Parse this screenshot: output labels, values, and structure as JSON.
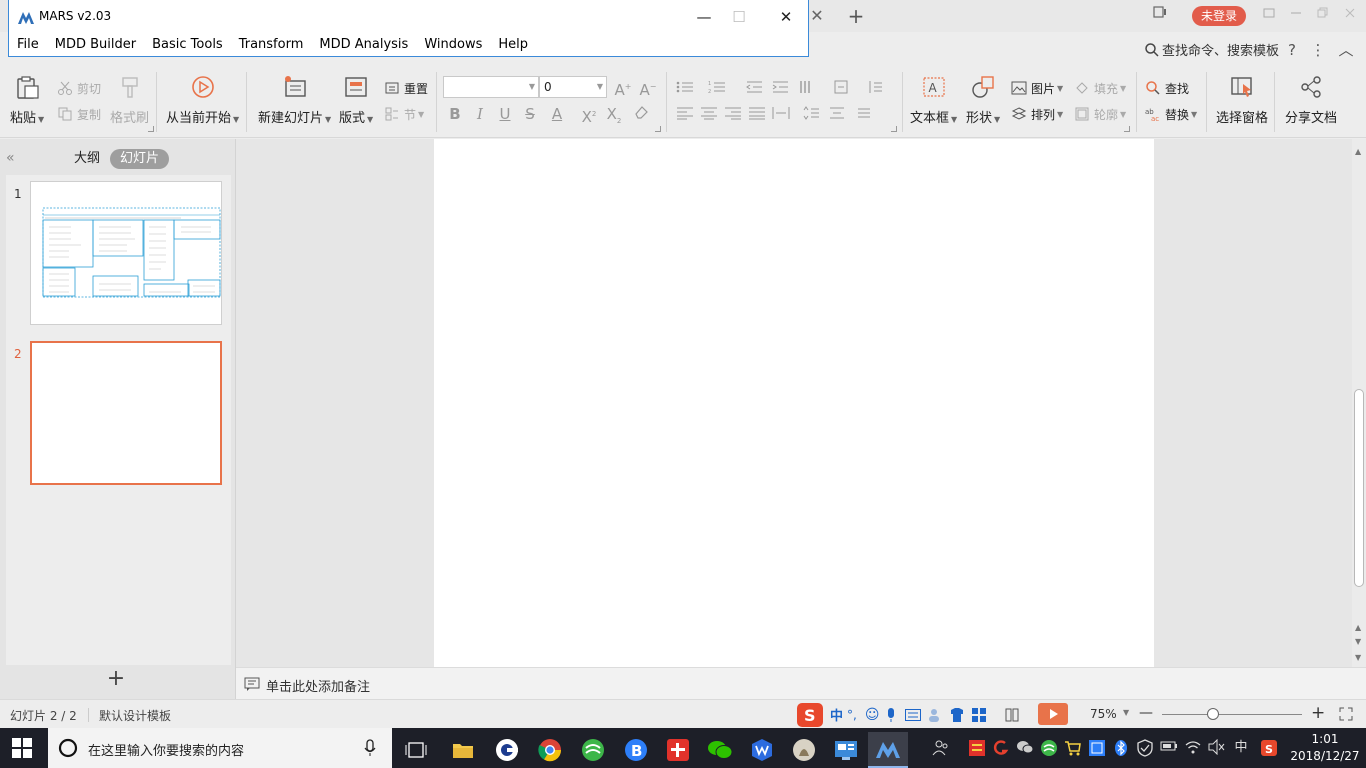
{
  "mars_window": {
    "title": "MARS v2.03",
    "menu": [
      "File",
      "MDD Builder",
      "Basic Tools",
      "Transform",
      "MDD Analysis",
      "Windows",
      "Help"
    ],
    "controls": {
      "minimize": "—",
      "maximize": "☐",
      "close": "✕"
    }
  },
  "wps_titlebar": {
    "tab_close": "✕",
    "new_tab": "+",
    "login": "未登录"
  },
  "search_row": {
    "command_search": "查找命令、搜索模板",
    "help": "?",
    "more": "⋮",
    "collapse": "︿"
  },
  "ribbon": {
    "paste": "粘贴",
    "cut": "剪切",
    "copy": "复制",
    "format_painter": "格式刷",
    "play_from_current": "从当前开始",
    "new_slide": "新建幻灯片",
    "layout": "版式",
    "reset": "重置",
    "section": "节",
    "font_size": "0",
    "textbox": "文本框",
    "shape": "形状",
    "picture": "图片",
    "fill": "填充",
    "arrange": "排列",
    "outline": "轮廓",
    "find": "查找",
    "replace": "替换",
    "selection_pane": "选择窗格",
    "share_doc": "分享文档"
  },
  "left_panel": {
    "collapse": "«",
    "tab_outline": "大纲",
    "tab_slides": "幻灯片",
    "slides": [
      {
        "number": "1",
        "selected": false
      },
      {
        "number": "2",
        "selected": true
      }
    ],
    "add_slide": "+"
  },
  "notes": {
    "placeholder": "单击此处添加备注"
  },
  "statusbar": {
    "slide_position": "幻灯片 2 / 2",
    "template": "默认设计模板",
    "zoom": "75%",
    "zoom_level_percent": 75,
    "zoom_out": "—",
    "zoom_in": "+"
  },
  "ime": {
    "lang": "中",
    "punct": "°,"
  },
  "taskbar": {
    "search_placeholder": "在这里输入你要搜索的内容",
    "tray_lang": "中",
    "time": "1:01",
    "date": "2018/12/27"
  },
  "colors": {
    "accent_orange": "#e8734a",
    "mars_border": "#3b8ad9",
    "login_red": "#e25c4b",
    "taskbar": "#1d1f28"
  }
}
